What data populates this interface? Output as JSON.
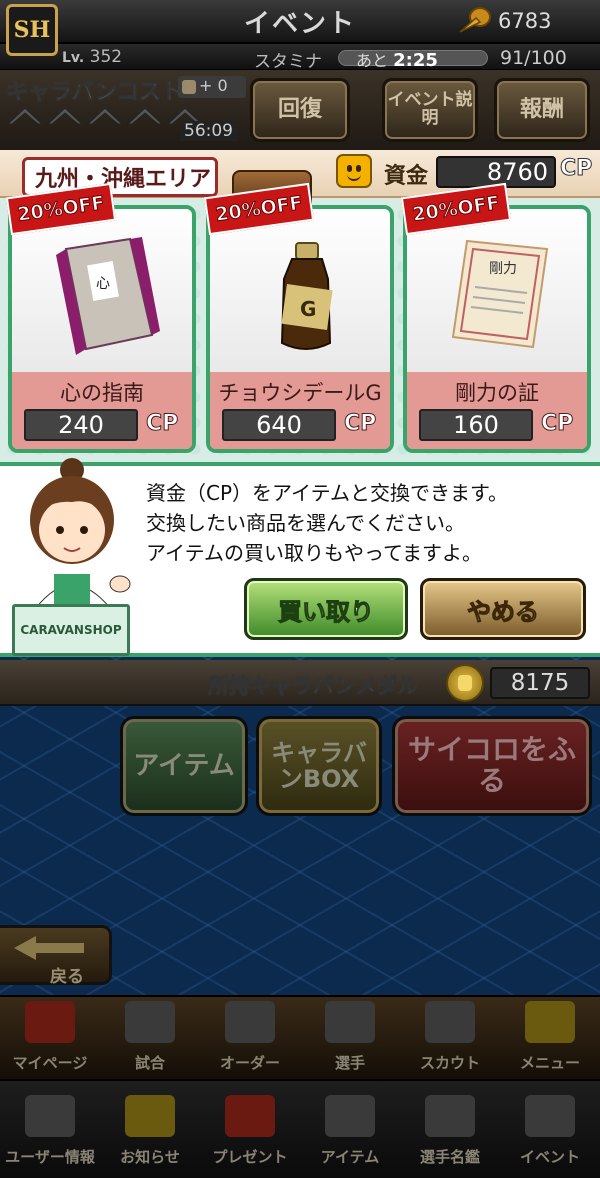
{
  "header": {
    "title": "イベント",
    "logo_text": "SH",
    "coins": "6783",
    "level_label": "Lv.",
    "level": "352",
    "stamina_label": "スタミナ",
    "stamina_remaining_label": "あと",
    "stamina_timer": "2:25",
    "stamina_value": "91/100"
  },
  "caravan": {
    "cost_title": "キャラバンコスト",
    "cost_plus": "+ 0",
    "timer": "56:09",
    "buttons": {
      "recover": "回復",
      "event_info": "イベント説明",
      "reward": "報酬"
    }
  },
  "shop": {
    "area_name": "九州・沖縄エリア",
    "funds_label": "資金",
    "funds_value": "8760",
    "currency": "CP",
    "items": [
      {
        "name": "心の指南",
        "price": "240",
        "discount": "20%OFF",
        "icon": "book-icon"
      },
      {
        "name": "チョウシデールG",
        "price": "640",
        "discount": "20%OFF",
        "icon": "bottle-icon"
      },
      {
        "name": "剛力の証",
        "price": "160",
        "discount": "20%OFF",
        "icon": "certificate-icon"
      }
    ]
  },
  "dialog": {
    "lines": [
      "資金（CP）をアイテムと交換できます。",
      "交換したい商品を選んでください。",
      "アイテムの買い取りもやってますよ。"
    ],
    "shop_sign": "CARAVANSHOP",
    "buyback_button": "買い取り",
    "quit_button": "やめる"
  },
  "medals": {
    "label": "所持キャラバンメダル",
    "value": "8175"
  },
  "actions": {
    "items": "アイテム",
    "caravan_box": "キャラバンBOX",
    "roll_dice": "サイコロをふる"
  },
  "back_label": "戻る",
  "nav_primary": [
    {
      "label": "マイページ",
      "icon": "mypage-icon"
    },
    {
      "label": "試合",
      "icon": "stadium-icon"
    },
    {
      "label": "オーダー",
      "icon": "field-icon"
    },
    {
      "label": "選手",
      "icon": "player-icon"
    },
    {
      "label": "スカウト",
      "icon": "scout-icon"
    },
    {
      "label": "メニュー",
      "icon": "menu-icon"
    }
  ],
  "nav_secondary": [
    {
      "label": "ユーザー情報",
      "icon": "user-info-icon"
    },
    {
      "label": "お知らせ",
      "icon": "notice-icon"
    },
    {
      "label": "プレゼント",
      "icon": "gift-icon"
    },
    {
      "label": "アイテム",
      "icon": "items-icon"
    },
    {
      "label": "選手名鑑",
      "icon": "player-list-icon"
    },
    {
      "label": "イベント",
      "icon": "event-icon"
    }
  ],
  "colors": {
    "shop_border": "#3aa36a",
    "discount_badge": "#c81616",
    "item_name_bg": "#e49a94"
  }
}
